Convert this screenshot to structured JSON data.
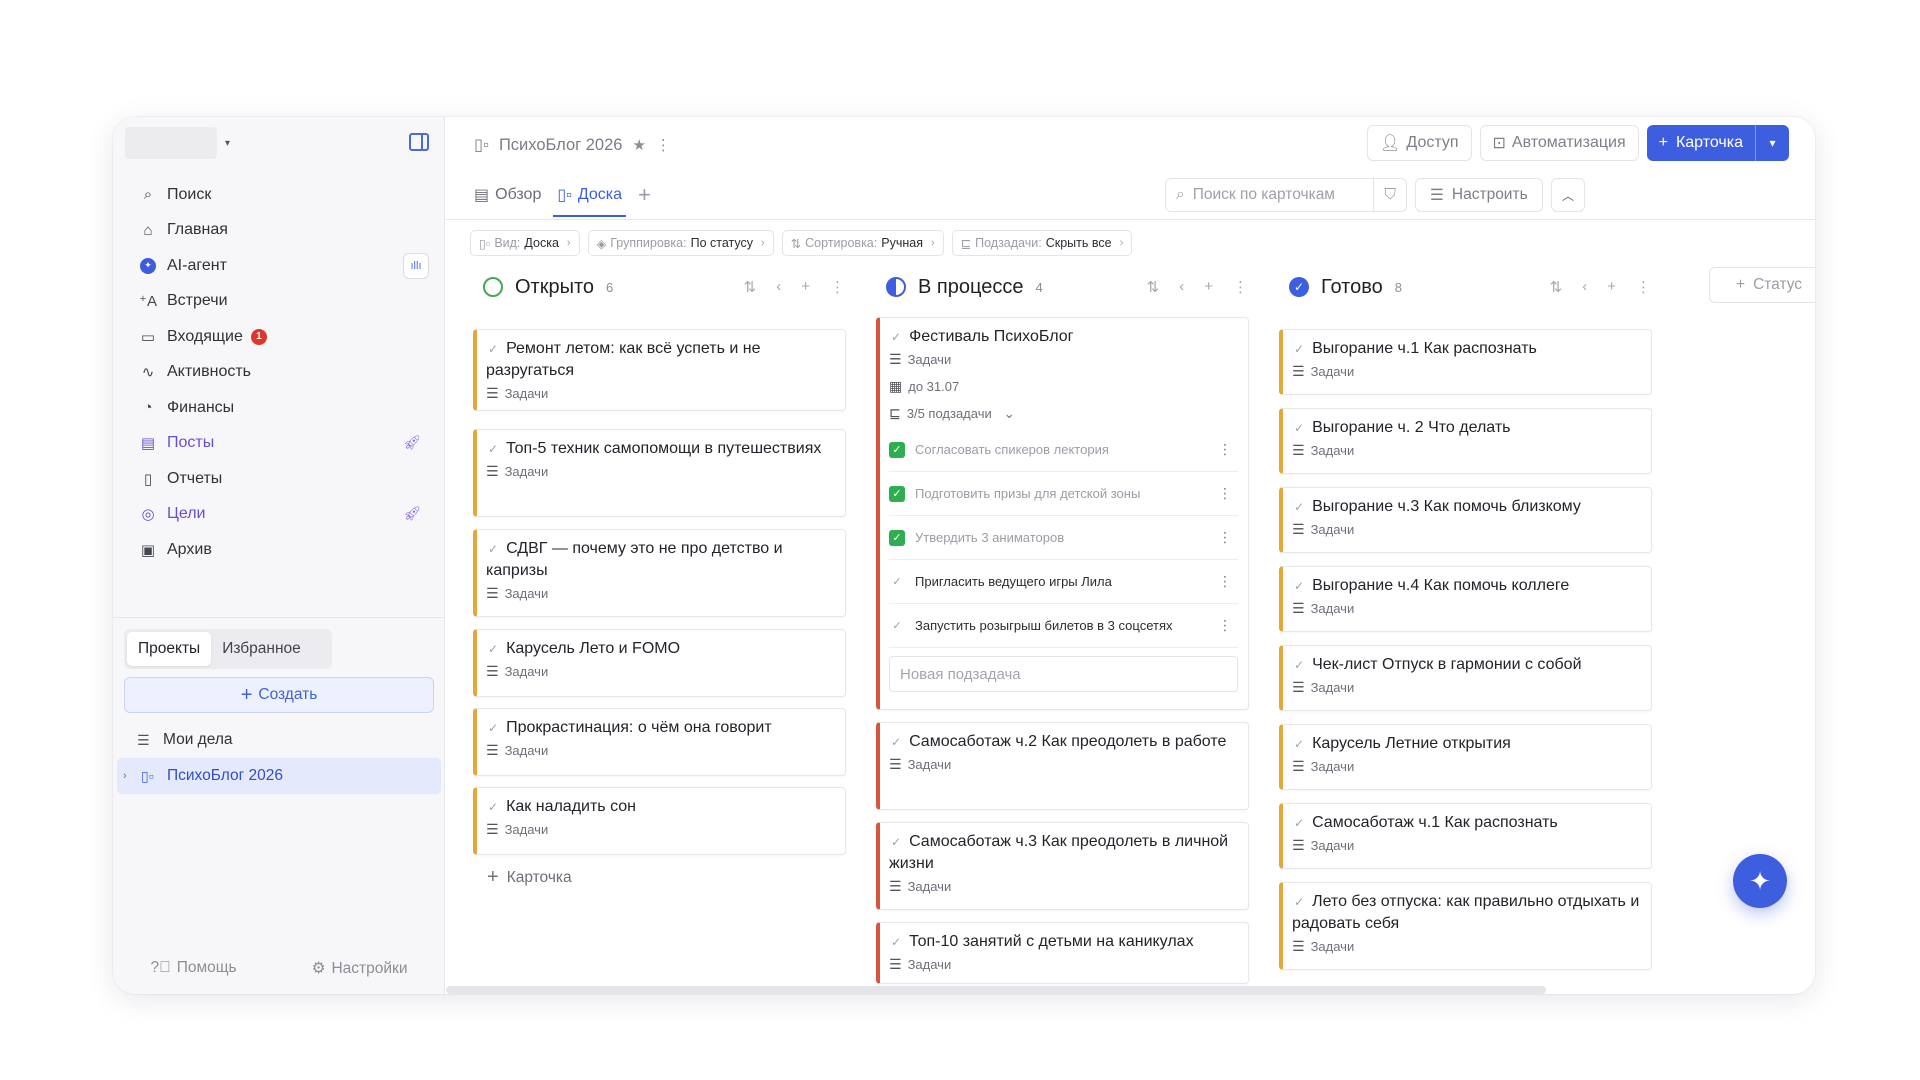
{
  "sidebar": {
    "nav": [
      {
        "label": "Поиск",
        "icon": "search-icon"
      },
      {
        "label": "Главная",
        "icon": "home-icon"
      },
      {
        "label": "AI-агент",
        "icon": "ai-agent-icon"
      },
      {
        "label": "Встречи",
        "icon": "meetings-icon"
      },
      {
        "label": "Входящие",
        "icon": "inbox-icon",
        "badge": "1"
      },
      {
        "label": "Активность",
        "icon": "activity-icon"
      },
      {
        "label": "Финансы",
        "icon": "finance-icon"
      },
      {
        "label": "Посты",
        "icon": "posts-icon"
      },
      {
        "label": "Отчеты",
        "icon": "reports-icon"
      },
      {
        "label": "Цели",
        "icon": "goals-icon"
      },
      {
        "label": "Архив",
        "icon": "archive-icon"
      }
    ],
    "tabs": [
      "Проекты",
      "Избранное"
    ],
    "create_label": "Создать",
    "projects": [
      "Мои дела",
      "ПсихоБлог 2026"
    ],
    "footer": {
      "help": "Помощь",
      "settings": "Настройки"
    }
  },
  "header": {
    "title": "ПсихоБлог 2026",
    "access": "Доступ",
    "automation": "Автоматизация",
    "card_btn": "Карточка",
    "tabs": [
      "Обзор",
      "Доска"
    ],
    "search_placeholder": "Поиск по карточкам",
    "configure": "Настроить"
  },
  "chips": [
    {
      "key": "Вид:",
      "value": "Доска"
    },
    {
      "key": "Группировка:",
      "value": "По статусу"
    },
    {
      "key": "Сортировка:",
      "value": "Ручная"
    },
    {
      "key": "Подзадачи:",
      "value": "Скрыть все"
    }
  ],
  "board": {
    "columns": [
      {
        "title": "Открыто",
        "count": "6",
        "cards": [
          "Ремонт летом: как всё успеть и не разругаться",
          "Топ-5 техник самопомощи в путешествиях",
          "СДВГ — почему это не про детство и капризы",
          "Карусель Лето и FOMO",
          "Прокрастинация: о чём она говорит",
          "Как наладить сон"
        ],
        "add_label": "Карточка"
      },
      {
        "title": "В процессе",
        "count": "4",
        "expanded": {
          "title": "Фестиваль ПсихоБлог",
          "meta": "Задачи",
          "due": "до 31.07",
          "subtasks_label": "3/5 подзадачи",
          "subtasks": [
            {
              "text": "Согласовать спикеров лектория",
              "done": true
            },
            {
              "text": "Подготовить призы для детской зоны",
              "done": true
            },
            {
              "text": "Утвердить 3 аниматоров",
              "done": true
            },
            {
              "text": "Пригласить ведущего игры Лила",
              "done": false
            },
            {
              "text": "Запустить розыгрыш билетов в 3 соцсетях",
              "done": false
            }
          ],
          "new_subtask_placeholder": "Новая подзадача"
        },
        "cards": [
          "Самосаботаж ч.2 Как преодолеть в работе",
          "Самосаботаж ч.3 Как преодолеть в личной жизни",
          "Топ-10 занятий с детьми на каникулах"
        ]
      },
      {
        "title": "Готово",
        "count": "8",
        "cards": [
          "Выгорание ч.1 Как распознать",
          "Выгорание ч. 2 Что делать",
          "Выгорание ч.3 Как помочь близкому",
          "Выгорание ч.4 Как помочь коллеге",
          "Чек-лист Отпуск в гармонии с собой",
          "Карусель Летние открытия",
          "Самосаботаж ч.1 Как распознать",
          "Лето без отпуска: как правильно отдыхать и радовать себя"
        ]
      }
    ],
    "card_meta": "Задачи",
    "add_status": "Статус"
  },
  "colors": {
    "accent": "#3e5ee0",
    "card_border": "#e3a73a",
    "in_progress_border": "#d8543b",
    "done_green": "#2fae51"
  }
}
